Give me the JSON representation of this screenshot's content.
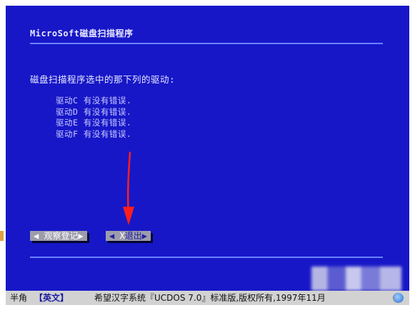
{
  "app": {
    "title": "MicroSoft磁盘扫描程序"
  },
  "main": {
    "prompt": "磁盘扫描程序选中的那下列的驱动:",
    "drives": [
      "驱动C 有没有错误.",
      "驱动D 有没有错误.",
      "驱动E 有没有错误.",
      "驱动F 有没有错误."
    ]
  },
  "buttons": {
    "observe_label": "◀ 观察登记▶",
    "exit_open": "◀ ",
    "exit_key": "X",
    "exit_rest": "退出▶"
  },
  "statusbar": {
    "mode": "半角",
    "lang": "【英文】",
    "text": "希望汉字系统『UCDOS 7.0』标准版,版权所有,1997年11月"
  },
  "colors": {
    "screen_bg": "#1717c8",
    "arrow": "#ff1e1e",
    "button_bg": "#9c9cac"
  },
  "icons": {
    "annotation": "red-arrow-down",
    "status": "globe-icon"
  }
}
